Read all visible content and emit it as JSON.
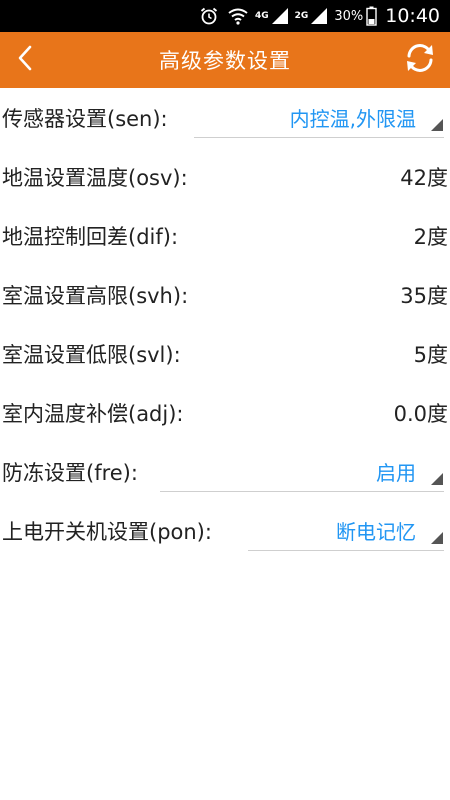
{
  "status_bar": {
    "net_4g": "4G",
    "net_2g": "2G",
    "battery": "30%",
    "time": "10:40"
  },
  "header": {
    "title": "高级参数设置"
  },
  "settings": [
    {
      "label": "传感器设置(sen):",
      "value": "内控温,外限温",
      "type": "dropdown"
    },
    {
      "label": "地温设置温度(osv):",
      "value": "42度",
      "type": "value"
    },
    {
      "label": "地温控制回差(dif):",
      "value": "2度",
      "type": "value"
    },
    {
      "label": "室温设置高限(svh):",
      "value": "35度",
      "type": "value"
    },
    {
      "label": "室温设置低限(svl):",
      "value": "5度",
      "type": "value"
    },
    {
      "label": "室内温度补偿(adj):",
      "value": "0.0度",
      "type": "value"
    },
    {
      "label": "防冻设置(fre):",
      "value": "启用",
      "type": "dropdown"
    },
    {
      "label": "上电开关机设置(pon):",
      "value": "断电记忆",
      "type": "dropdown"
    }
  ],
  "colors": {
    "appbar": "#E8751A",
    "accent": "#2196F3"
  }
}
